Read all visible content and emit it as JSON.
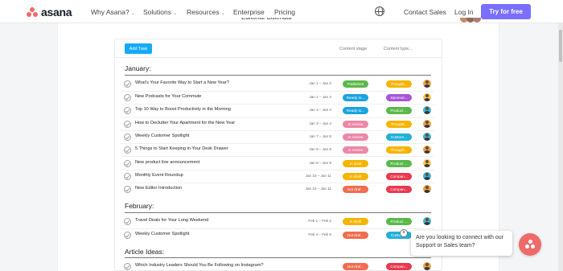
{
  "nav": {
    "brand": "asana",
    "links": [
      {
        "label": "Why Asana?",
        "dropdown": true
      },
      {
        "label": "Solutions",
        "dropdown": true
      },
      {
        "label": "Resources",
        "dropdown": true
      },
      {
        "label": "Enterprise",
        "dropdown": false
      },
      {
        "label": "Pricing",
        "dropdown": false
      }
    ],
    "contact_sales": "Contact Sales",
    "login": "Log In",
    "cta": "Try for free",
    "chevron": "⌄"
  },
  "page": {
    "title": "Editorial Calendar"
  },
  "toolbar": {
    "add_task": "Add Task",
    "col_stage": "Content stage",
    "col_type": "Content type..."
  },
  "sections": [
    {
      "name": "January:",
      "rows": [
        {
          "task": "What's Your Favorite Way to Start a New Year?",
          "date": "Jan 1 – Jan 2",
          "stage": "Published",
          "stage_color": "#5ab84a",
          "type": "Thought...",
          "type_color": "#f5b400",
          "avatar_color": "#e8a23b"
        },
        {
          "task": "New Podcasts for Your Commute",
          "date": "Jan 1 – Jan 3",
          "stage": "Ready to...",
          "stage_color": "#1aa3e0",
          "type": "Sponsor...",
          "type_color": "#a855d6",
          "avatar_color": "#f2c94c"
        },
        {
          "task": "Top 10 Way to Boost Productivity in the Morning",
          "date": "Jan 3 – Jan 4",
          "stage": "Ready to...",
          "stage_color": "#1aa3e0",
          "type": "Product ...",
          "type_color": "#5ab84a",
          "avatar_color": "#3bb4c9"
        },
        {
          "task": "How to Declutter Your Apartment for the New Year",
          "date": "Jan 3 – Jan 4",
          "stage": "In review",
          "stage_color": "#ee86a6",
          "type": "Thought...",
          "type_color": "#f5b400",
          "avatar_color": "#e8a23b"
        },
        {
          "task": "Weekly Customer Spotlight",
          "date": "Jan 7 – Jan 8",
          "stage": "In review",
          "stage_color": "#ee86a6",
          "type": "Custom...",
          "type_color": "#21b1d8",
          "avatar_color": "#3bb4c9"
        },
        {
          "task": "5 Things to Start Keeping in Your Desk Drawer",
          "date": "Jan 8 – Jan 9",
          "stage": "In review",
          "stage_color": "#ee86a6",
          "type": "Thought...",
          "type_color": "#f5b400",
          "avatar_color": "#e8a23b"
        },
        {
          "task": "New product line announcement",
          "date": "Jan 8 – Jan 9",
          "stage": "In draft",
          "stage_color": "#f5b400",
          "type": "Product ...",
          "type_color": "#5ab84a",
          "avatar_color": "#f2c94c"
        },
        {
          "task": "Monthly Event Roundup",
          "date": "Jan 10 – Jan 11",
          "stage": "In draft",
          "stage_color": "#f5b400",
          "type": "Compan...",
          "type_color": "#e8384f",
          "avatar_color": "#3bb4c9"
        },
        {
          "task": "New Editor Introduction",
          "date": "Jan 10 – Jan 11",
          "stage": "Not draf...",
          "stage_color": "#f26b4f",
          "type": "Compan...",
          "type_color": "#e8384f",
          "avatar_color": "#e8a23b"
        }
      ]
    },
    {
      "name": "February:",
      "rows": [
        {
          "task": "Travel Deals for Your Long Weekend",
          "date": "Feb 1 – Feb 2",
          "stage": "In draft",
          "stage_color": "#f5b400",
          "type": "Product ...",
          "type_color": "#5ab84a",
          "avatar_color": "#3bb4c9"
        },
        {
          "task": "Weekly Customer Spotlight",
          "date": "Feb 4 – Feb 5",
          "stage": "Not draf...",
          "stage_color": "#f26b4f",
          "type": "Custom...",
          "type_color": "#21b1d8",
          "avatar_color": "#e8a23b"
        }
      ]
    },
    {
      "name": "Article Ideas:",
      "rows": [
        {
          "task": "Which Industry Leaders Should You Be Following on Instagram?",
          "date": "",
          "stage": "Not draf...",
          "stage_color": "#f26b4f",
          "type": "Compan...",
          "type_color": "#e8384f",
          "avatar_color": "#e8a23b"
        }
      ]
    }
  ],
  "chat": {
    "message": "Are you looking to connect with our Support or Sales team?",
    "close": "×"
  }
}
